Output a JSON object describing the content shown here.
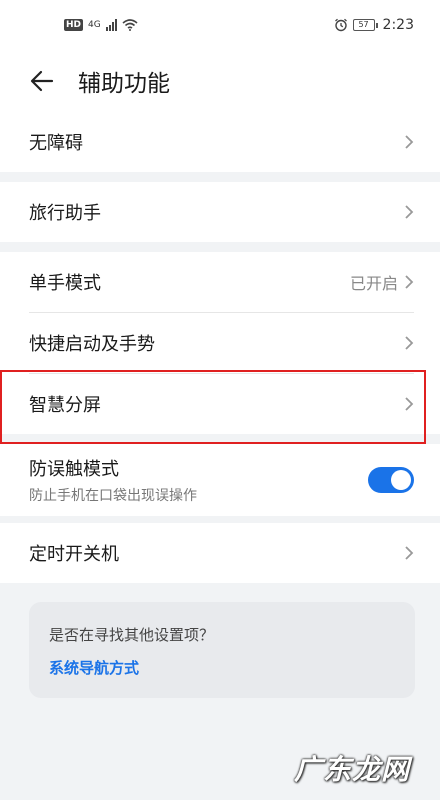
{
  "status_bar": {
    "hd": "HD",
    "signal": "4G",
    "battery": "57",
    "time": "2:23"
  },
  "header": {
    "title": "辅助功能"
  },
  "groups": [
    {
      "items": [
        {
          "label": "无障碍"
        }
      ]
    },
    {
      "items": [
        {
          "label": "旅行助手"
        }
      ]
    },
    {
      "items": [
        {
          "label": "单手模式",
          "value": "已开启"
        },
        {
          "label": "快捷启动及手势"
        },
        {
          "label": "智慧分屏"
        }
      ]
    },
    {
      "items": [
        {
          "label": "防误触模式",
          "subtitle": "防止手机在口袋出现误操作",
          "toggle_on": true
        }
      ]
    },
    {
      "items": [
        {
          "label": "定时开关机"
        }
      ]
    }
  ],
  "search_card": {
    "question": "是否在寻找其他设置项？",
    "link": "系统导航方式"
  },
  "watermark": "广东龙网",
  "colors": {
    "accent": "#1a73e8",
    "highlight": "#e02020"
  }
}
